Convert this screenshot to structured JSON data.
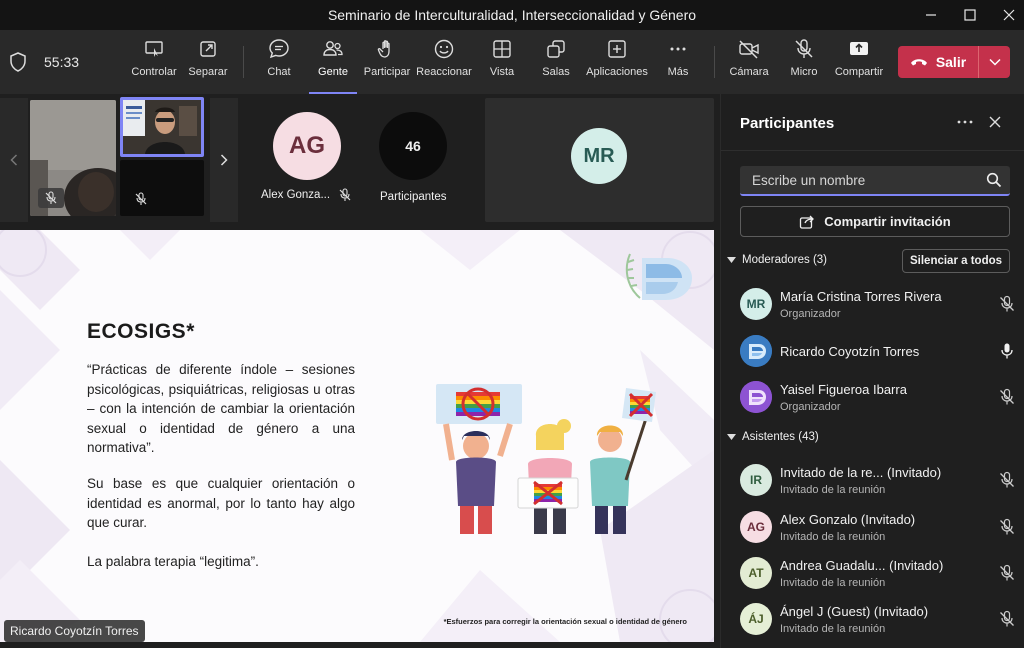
{
  "window": {
    "title": "Seminario de Interculturalidad, Interseccionalidad y Género"
  },
  "toolbar": {
    "timer": "55:33",
    "buttons": {
      "control": "Controlar",
      "separate": "Separar",
      "chat": "Chat",
      "people": "Gente",
      "raise": "Participar",
      "react": "Reaccionar",
      "view": "Vista",
      "rooms": "Salas",
      "apps": "Aplicaciones",
      "more": "Más",
      "camera": "Cámara",
      "mic": "Micro",
      "share": "Compartir"
    },
    "leave_label": "Salir"
  },
  "stage": {
    "tile_ag": {
      "initials": "AG",
      "name": "Alex Gonza..."
    },
    "tile_count": {
      "count": "46",
      "label": "Participantes"
    },
    "tile_mr": {
      "initials": "MR"
    },
    "slide": {
      "title": "ECOSIGS*",
      "paragraph1": "“Prácticas de diferente índole – sesiones psicológicas, psiquiátricas, religiosas u otras – con la intención de cambiar la orientación sexual o identidad de género a una normativa”.",
      "paragraph2": "Su base es que cualquier orientación o identidad es anormal, por lo tanto hay algo que curar.",
      "paragraph3": "La palabra terapia “legitima”.",
      "footnote": "*Esfuerzos para corregir la orientación sexual o identidad de género"
    },
    "presenter_label": "Ricardo Coyotzín Torres"
  },
  "panel": {
    "title": "Participantes",
    "search_placeholder": "Escribe un nombre",
    "share_invite": "Compartir invitación",
    "moderators_label": "Moderadores (3)",
    "mute_all": "Silenciar a todos",
    "attendees_label": "Asistentes (43)",
    "moderators": [
      {
        "initials": "MR",
        "name": "María Cristina Torres Rivera",
        "role": "Organizador",
        "mic": "off"
      },
      {
        "initials": "",
        "name": "Ricardo Coyotzín Torres",
        "role": "",
        "mic": "on"
      },
      {
        "initials": "",
        "name": "Yaisel Figueroa Ibarra",
        "role": "Organizador",
        "mic": "off"
      }
    ],
    "attendees": [
      {
        "initials": "IR",
        "name": "Invitado de la re...  (Invitado)",
        "role": "Invitado de la reunión"
      },
      {
        "initials": "AG",
        "name": "Alex Gonzalo (Invitado)",
        "role": "Invitado de la reunión"
      },
      {
        "initials": "AT",
        "name": "Andrea Guadalu...  (Invitado)",
        "role": "Invitado de la reunión"
      },
      {
        "initials": "ÁJ",
        "name": "Ángel J (Guest) (Invitado)",
        "role": "Invitado de la reunión"
      }
    ]
  },
  "colors": {
    "leave": "#c4314b",
    "accent": "#7f85f5",
    "avatar_mr": "#d4eee9",
    "avatar_ag": "#f6dde3"
  }
}
